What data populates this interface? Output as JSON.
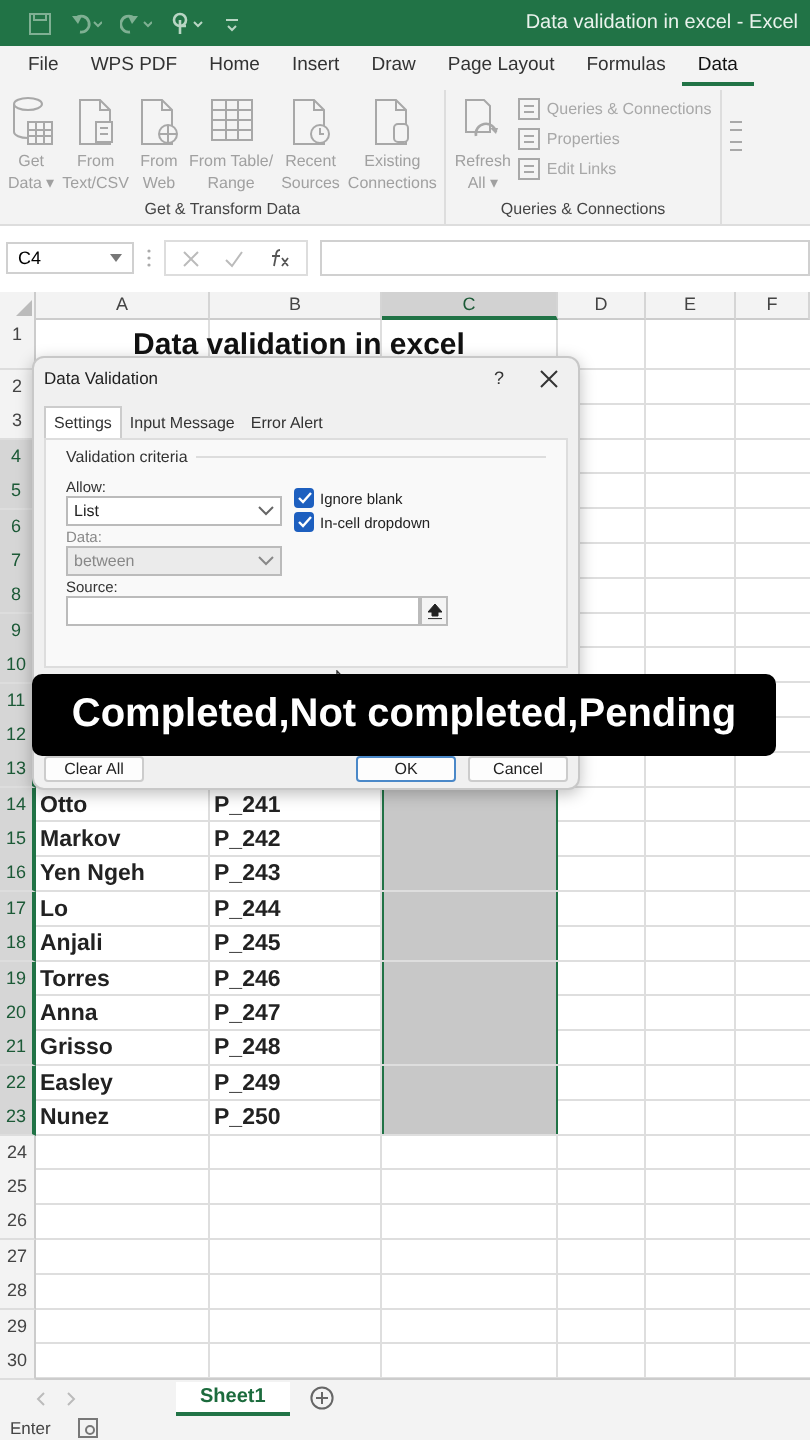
{
  "title_bar": {
    "title": "Data validation in excel  -  Excel"
  },
  "ribbon": {
    "tabs": [
      {
        "label": "File",
        "selected": false
      },
      {
        "label": "WPS PDF",
        "selected": false
      },
      {
        "label": "Home",
        "selected": false
      },
      {
        "label": "Insert",
        "selected": false
      },
      {
        "label": "Draw",
        "selected": false
      },
      {
        "label": "Page Layout",
        "selected": false
      },
      {
        "label": "Formulas",
        "selected": false
      },
      {
        "label": "Data",
        "selected": true
      }
    ],
    "groups": [
      {
        "label": "Get & Transform Data",
        "buttons": [
          {
            "lines": [
              "Get",
              "Data ▾"
            ]
          },
          {
            "lines": [
              "From",
              "Text/CSV"
            ]
          },
          {
            "lines": [
              "From",
              "Web"
            ]
          },
          {
            "lines": [
              "From Table/",
              "Range"
            ]
          },
          {
            "lines": [
              "Recent",
              "Sources"
            ]
          },
          {
            "lines": [
              "Existing",
              "Connections"
            ]
          }
        ]
      },
      {
        "label": "Queries & Connections",
        "buttons": [
          {
            "lines": [
              "Refresh",
              "All ▾"
            ]
          }
        ],
        "small_buttons": [
          "Queries & Connections",
          "Properties",
          "Edit Links"
        ]
      }
    ]
  },
  "formula_bar": {
    "name_box": "C4"
  },
  "sheet": {
    "columns": [
      {
        "label": "A",
        "selected": false
      },
      {
        "label": "B",
        "selected": false
      },
      {
        "label": "C",
        "selected": true
      },
      {
        "label": "D",
        "selected": false
      },
      {
        "label": "E",
        "selected": false
      },
      {
        "label": "F",
        "selected": false
      }
    ],
    "rows": [
      {
        "number": "1",
        "title": "Data validation in excel",
        "in_selection": false
      },
      {
        "number": "2",
        "in_selection": false
      },
      {
        "number": "3",
        "in_selection": false
      },
      {
        "number": "4",
        "in_selection": true
      },
      {
        "number": "5",
        "in_selection": true
      },
      {
        "number": "6",
        "in_selection": true
      },
      {
        "number": "7",
        "in_selection": true
      },
      {
        "number": "8",
        "in_selection": true
      },
      {
        "number": "9",
        "in_selection": true
      },
      {
        "number": "10",
        "in_selection": true
      },
      {
        "number": "11",
        "in_selection": true
      },
      {
        "number": "12",
        "in_selection": true
      },
      {
        "number": "13",
        "in_selection": true
      },
      {
        "number": "14",
        "a": "Otto",
        "b": "P_241",
        "in_selection": true
      },
      {
        "number": "15",
        "a": "Markov",
        "b": "P_242",
        "in_selection": true
      },
      {
        "number": "16",
        "a": "Yen Ngeh",
        "b": "P_243",
        "in_selection": true
      },
      {
        "number": "17",
        "a": "Lo",
        "b": "P_244",
        "in_selection": true
      },
      {
        "number": "18",
        "a": "Anjali",
        "b": "P_245",
        "in_selection": true
      },
      {
        "number": "19",
        "a": "Torres",
        "b": "P_246",
        "in_selection": true
      },
      {
        "number": "20",
        "a": "Anna",
        "b": "P_247",
        "in_selection": true
      },
      {
        "number": "21",
        "a": "Grisso",
        "b": "P_248",
        "in_selection": true
      },
      {
        "number": "22",
        "a": "Easley",
        "b": "P_249",
        "in_selection": true
      },
      {
        "number": "23",
        "a": "Nunez",
        "b": "P_250",
        "in_selection": true
      },
      {
        "number": "24",
        "in_selection": false
      },
      {
        "number": "25",
        "in_selection": false
      },
      {
        "number": "26",
        "in_selection": false
      },
      {
        "number": "27",
        "in_selection": false
      },
      {
        "number": "28",
        "in_selection": false
      },
      {
        "number": "29",
        "in_selection": false
      },
      {
        "number": "30",
        "in_selection": false
      }
    ]
  },
  "dialog": {
    "title": "Data Validation",
    "help": "?",
    "tabs": [
      {
        "label": "Settings",
        "selected": true
      },
      {
        "label": "Input Message",
        "selected": false
      },
      {
        "label": "Error Alert",
        "selected": false
      }
    ],
    "section": "Validation criteria",
    "allow_label": "Allow:",
    "allow_value": "List",
    "data_label": "Data:",
    "data_value": "between",
    "data_disabled": true,
    "checkboxes": [
      {
        "label": "Ignore blank",
        "checked": true
      },
      {
        "label": "In-cell dropdown",
        "checked": true
      }
    ],
    "source_label": "Source:",
    "buttons": [
      {
        "label": "Clear All",
        "kind": "left"
      },
      {
        "label": "OK",
        "kind": "default"
      },
      {
        "label": "Cancel",
        "kind": "normal"
      }
    ]
  },
  "caption": "Completed,Not completed,Pending",
  "sheet_tabs": [
    {
      "label": "Sheet1",
      "selected": true
    }
  ],
  "status_bar": {
    "mode": "Enter"
  }
}
